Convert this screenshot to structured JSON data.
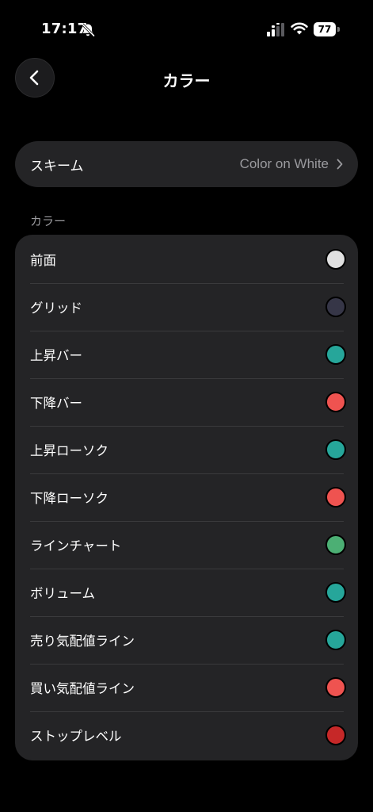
{
  "status_bar": {
    "time": "17:17",
    "battery": "77"
  },
  "nav": {
    "title": "カラー"
  },
  "scheme": {
    "label": "スキーム",
    "value": "Color on White"
  },
  "colors_section": {
    "header": "カラー",
    "items": [
      {
        "label": "前面",
        "color": "#e0e0e0"
      },
      {
        "label": "グリッド",
        "color": "#363647"
      },
      {
        "label": "上昇バー",
        "color": "#26a69a"
      },
      {
        "label": "下降バー",
        "color": "#ef5350"
      },
      {
        "label": "上昇ローソク",
        "color": "#26a69a"
      },
      {
        "label": "下降ローソク",
        "color": "#ef5350"
      },
      {
        "label": "ラインチャート",
        "color": "#4caf74"
      },
      {
        "label": "ボリューム",
        "color": "#26a69a"
      },
      {
        "label": "売り気配値ライン",
        "color": "#26a69a"
      },
      {
        "label": "買い気配値ライン",
        "color": "#ef5350"
      },
      {
        "label": "ストップレベル",
        "color": "#c62828"
      }
    ]
  }
}
